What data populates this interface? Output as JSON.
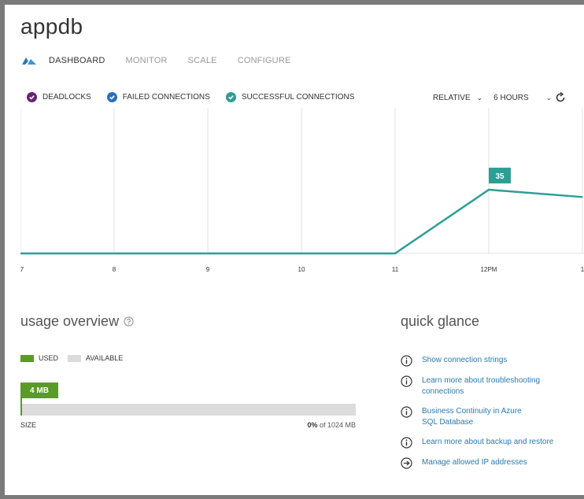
{
  "title": "appdb",
  "tabs": [
    {
      "label": "DASHBOARD",
      "active": true
    },
    {
      "label": "MONITOR",
      "active": false
    },
    {
      "label": "SCALE",
      "active": false
    },
    {
      "label": "CONFIGURE",
      "active": false
    }
  ],
  "legend": [
    {
      "label": "DEADLOCKS",
      "color": "#68217a"
    },
    {
      "label": "FAILED CONNECTIONS",
      "color": "#2a6ebb"
    },
    {
      "label": "SUCCESSFUL CONNECTIONS",
      "color": "#2d9e94"
    }
  ],
  "controls": {
    "range_mode": "RELATIVE",
    "range_value": "6 HOURS"
  },
  "chart_data": {
    "type": "line",
    "x": [
      "7",
      "8",
      "9",
      "10",
      "11",
      "12PM",
      "1"
    ],
    "series": [
      {
        "values": [
          0,
          0,
          0,
          0,
          0,
          35,
          31
        ],
        "color": "#2d9e94"
      }
    ],
    "data_labels": [
      {
        "x": "12PM",
        "value": "35"
      }
    ],
    "ylim": [
      0,
      80
    ],
    "grid": true
  },
  "usage": {
    "title": "usage overview",
    "legend_used": "USED",
    "legend_available": "AVAILABLE",
    "used_badge": "4 MB",
    "used_fraction": 0.004,
    "size_label": "SIZE",
    "size_percent": "0%",
    "size_of": "of 1024 MB",
    "used_color": "#5a9a27",
    "available_color": "#dcdcdc"
  },
  "quick_glance": {
    "title": "quick glance",
    "links": [
      {
        "icon": "info-icon",
        "label": "Show connection strings"
      },
      {
        "icon": "info-icon",
        "label": "Learn more about troubleshooting connections"
      },
      {
        "icon": "info-icon",
        "label": "Business Continuity in Azure SQL Database"
      },
      {
        "icon": "info-icon",
        "label": "Learn more about backup and restore"
      },
      {
        "icon": "arrow-right-icon",
        "label": "Manage allowed IP addresses"
      }
    ],
    "link_color": "#2a7ab0"
  }
}
